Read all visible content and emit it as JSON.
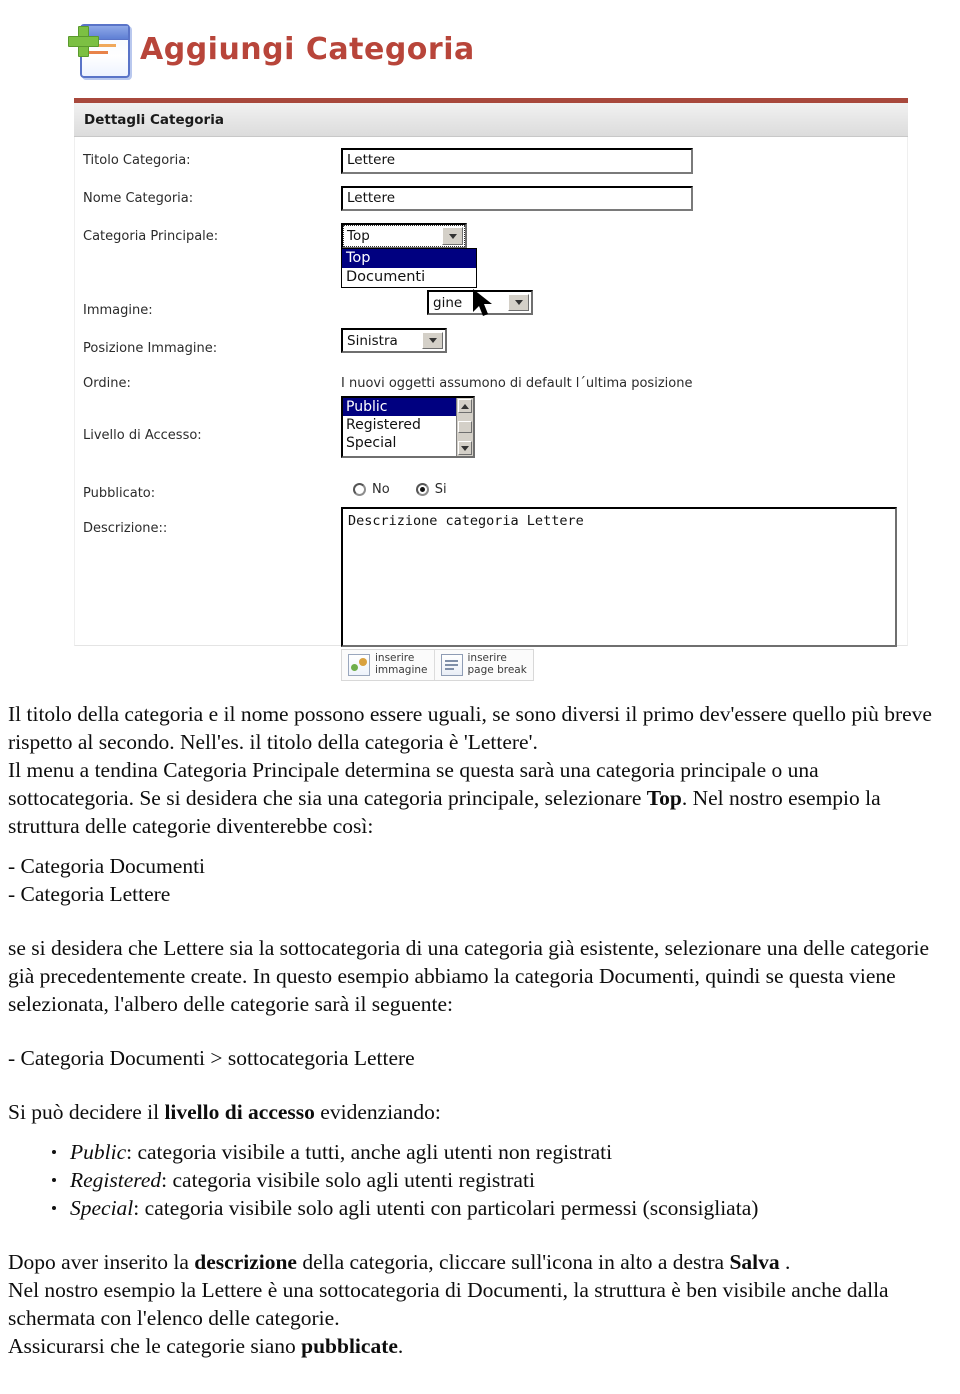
{
  "screenshot": {
    "title": "Aggiungi Categoria",
    "title_icon": "add-category-icon",
    "panel": {
      "heading": "Dettagli Categoria",
      "fields": {
        "titolo_label": "Titolo Categoria:",
        "titolo_value": "Lettere",
        "nome_label": "Nome Categoria:",
        "nome_value": "Lettere",
        "categoria_principale_label": "Categoria Principale:",
        "categoria_principale_value": "Top",
        "categoria_principale_options": [
          "Top",
          "Documenti"
        ],
        "categoria_principale_selected_option": "Top",
        "immagine_label": "Immagine:",
        "immagine_value": "gine",
        "posizione_label": "Posizione Immagine:",
        "posizione_value": "Sinistra",
        "ordine_label": "Ordine:",
        "ordine_text": "I nuovi oggetti assumono di default l´ultima posizione",
        "livello_label": "Livello di Accesso:",
        "livello_options": [
          "Public",
          "Registered",
          "Special"
        ],
        "livello_selected": "Public",
        "pubblicato_label": "Pubblicato:",
        "pubblicato_no": "No",
        "pubblicato_si": "Si",
        "pubblicato_selected": "Si",
        "descrizione_label": "Descrizione::",
        "descrizione_value": "Descrizione categoria Lettere"
      },
      "toolbar": {
        "insert_image": "inserire\nimmagine",
        "insert_page_break": "inserire\npage break"
      }
    },
    "colors": {
      "title_text": "#b8453a",
      "panel_top_border": "#a8483c",
      "selection_blue": "#000080",
      "plus_green": "#7cc043"
    }
  },
  "doc": {
    "p1_a": "Il titolo della categoria e il nome possono essere uguali, se sono diversi il primo dev'essere quello più breve rispetto al secondo. Nell'es. il titolo della categoria è 'Lettere'.",
    "p2_a": "Il menu a tendina Categoria Principale determina se questa sarà una categoria principale o una sottocategoria. Se si desidera che sia una categoria principale, selezionare ",
    "p2_b": "Top",
    "p2_c": ". Nel nostro esempio la struttura delle categorie diventerebbe così:",
    "tree1": "- Categoria Documenti",
    "tree2": "- Categoria Lettere",
    "p3": "se si desidera che Lettere sia la sottocategoria di una categoria già esistente, selezionare una delle categorie già precedentemente create. In questo esempio abbiamo la categoria Documenti, quindi se questa viene selezionata, l'albero delle categorie sarà il seguente:",
    "tree3": "- Categoria Documenti > sottocategoria Lettere",
    "p4_a": "Si può decidere il ",
    "p4_b": "livello di accesso",
    "p4_c": " evidenziando:",
    "bullets": [
      {
        "term": "Public",
        "text": ": categoria visibile a tutti, anche agli utenti non registrati"
      },
      {
        "term": "Registered",
        "text": ": categoria visibile solo agli utenti registrati"
      },
      {
        "term": "Special",
        "text": ": categoria visibile solo agli utenti con particolari permessi (sconsigliata)"
      }
    ],
    "p5_a": "Dopo aver inserito la ",
    "p5_b": "descrizione",
    "p5_c": " della categoria, cliccare sull'icona in alto a destra ",
    "p5_d": "Salva",
    "p5_e": " .",
    "p6": "Nel nostro esempio la Lettere è una sottocategoria di Documenti, la struttura è ben visibile anche dalla schermata con l'elenco delle categorie.",
    "p7_a": "Assicurarsi che le categorie siano ",
    "p7_b": "pubblicate",
    "p7_c": "."
  }
}
